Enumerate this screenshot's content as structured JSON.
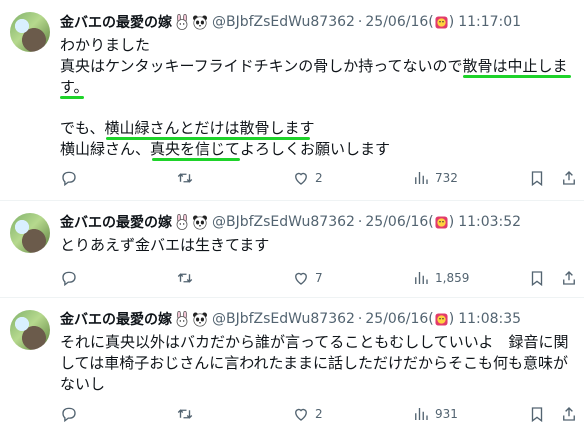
{
  "posts": [
    {
      "display_name": "金バエの最愛の嫁",
      "handle": "@BJbfZsEdWu87362",
      "dot": "·",
      "date": "25/06/16(",
      "date_close": ")",
      "time": "11:17:01",
      "lines": [
        "わかりました",
        "真央はケンタッキーフライドチキンの骨しか持ってないので散骨は中止しま",
        "す。",
        "",
        "でも、横山緑さんとだけは散骨します",
        "横山緑さん、真央を信じてよろしくお願いします"
      ],
      "reply_count": "",
      "retweet_count": "",
      "like_count": "2",
      "view_count": "732"
    },
    {
      "display_name": "金バエの最愛の嫁",
      "handle": "@BJbfZsEdWu87362",
      "dot": "·",
      "date": "25/06/16(",
      "date_close": ")",
      "time": "11:03:52",
      "lines": [
        "とりあえず金バエは生きてます"
      ],
      "reply_count": "",
      "retweet_count": "",
      "like_count": "7",
      "view_count": "1,859"
    },
    {
      "display_name": "金バエの最愛の嫁",
      "handle": "@BJbfZsEdWu87362",
      "dot": "·",
      "date": "25/06/16(",
      "date_close": ")",
      "time": "11:08:35",
      "lines": [
        "それに真央以外はバカだから誰が言ってることもむししていいよ　録音に関",
        "しては車椅子おじさんに言われたままに話しただけだからそこも何も意味が",
        "ないし"
      ],
      "reply_count": "",
      "retweet_count": "",
      "like_count": "2",
      "view_count": "931"
    }
  ],
  "icons": {
    "reply": "reply-icon",
    "retweet": "retweet-icon",
    "like": "like-icon",
    "views": "views-icon",
    "bookmark": "bookmark-icon",
    "share": "share-icon"
  },
  "colors": {
    "highlight": "#1ed32a",
    "muted": "#536471",
    "text": "#0f1419"
  }
}
